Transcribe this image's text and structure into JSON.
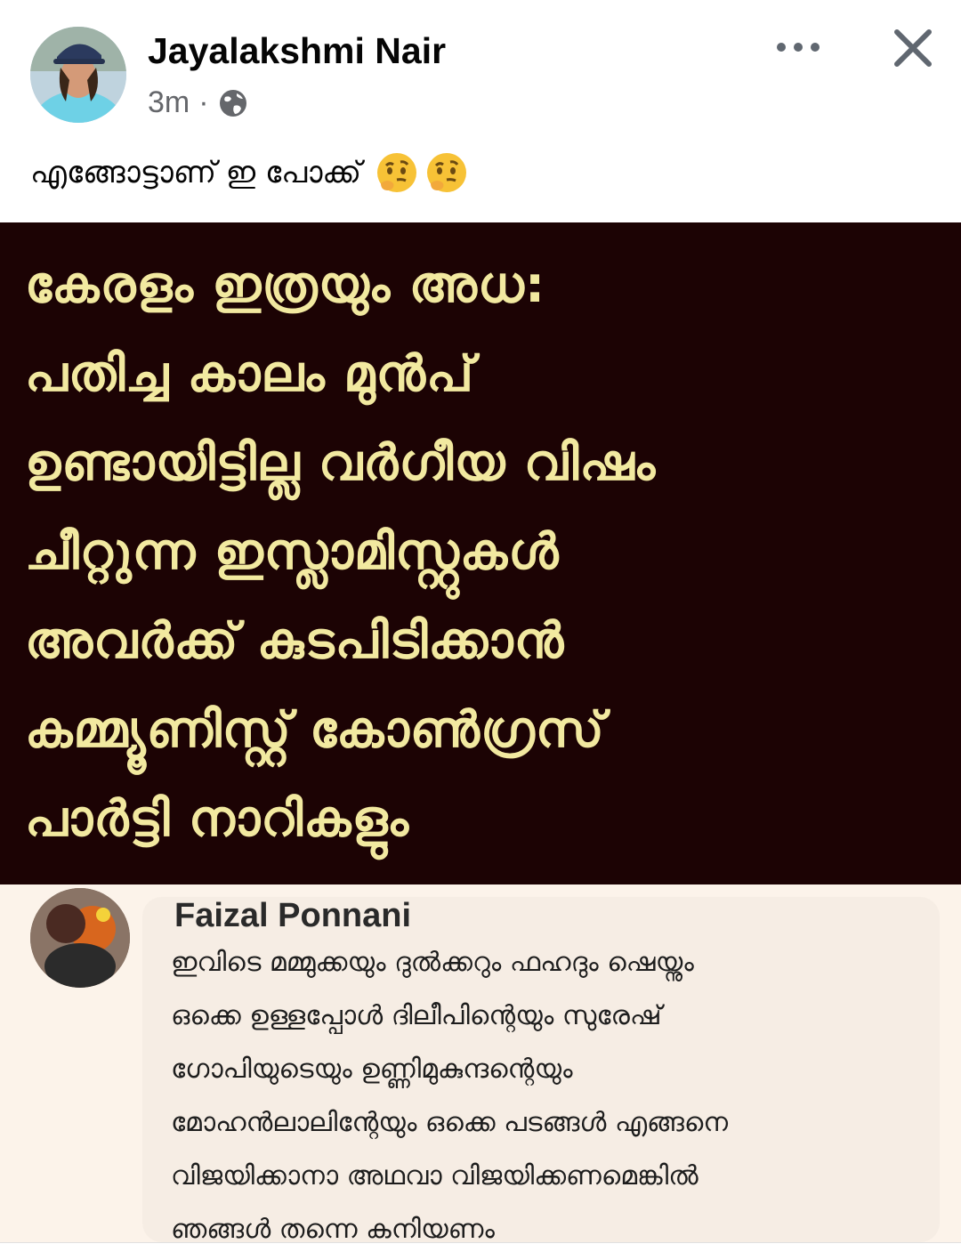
{
  "post": {
    "author_name": "Jayalakshmi Nair",
    "timestamp": "3m",
    "separator": "·",
    "privacy_icon": "globe-icon",
    "more_icon": "more-horizontal-icon",
    "close_icon": "close-icon",
    "caption": "എങ്ങോട്ടാണ് ഇ പോക്ക്",
    "caption_emojis": [
      "thinking-face-icon",
      "thinking-face-icon"
    ]
  },
  "image": {
    "background_color": "#1c0304",
    "text_color": "#f2e9a0",
    "lines": [
      "കേരളം ഇത്രയും അധ:",
      "പതിച്ച കാലം മുൻപ്",
      "ഉണ്ടായിട്ടില്ല വർഗീയ വിഷം",
      "ചീറ്റുന്ന ഇസ്ലാമിസ്റ്റുകൾ",
      "അവർക്ക് കുടപിടിക്കാൻ",
      "കമ്മ്യൂണിസ്റ്റ് കോൺഗ്രസ്",
      "പാർട്ടി നാറികളും"
    ]
  },
  "comment": {
    "author_name": "Faizal Ponnani",
    "lines": [
      "ഇവിടെ മമ്മുക്കയും ദുൽക്കറും ഫഹദും  ഷെയ്നും",
      "ഒക്കെ ഉള്ളപ്പോൾ ദിലീപിന്റെയും സുരേഷ്",
      "ഗോപിയുടെയും ഉണ്ണിമുകുന്ദന്റെയും",
      "മോഹൻലാലിന്റേയും ഒക്കെ പടങ്ങൾ എങ്ങനെ",
      "വിജയിക്കാനാ അഥവാ വിജയിക്കണമെങ്കിൽ",
      "ഞങ്ങൾ തന്നെ കനിയണം"
    ]
  }
}
